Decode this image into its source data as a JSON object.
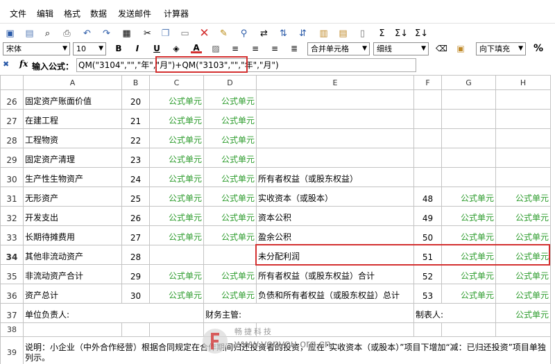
{
  "menu": [
    "文件",
    "编辑",
    "格式",
    "数据",
    "发送邮件",
    "计算器"
  ],
  "toolbar": {
    "font_name": "宋体",
    "font_size": "10",
    "bold": "B",
    "italic": "I",
    "underline": "U",
    "font_color": "A",
    "merge_label": "合并单元格",
    "border_label": "细线",
    "fill_label": "向下填充",
    "percent": "%",
    "sum": "Σ",
    "sum2": "Σ↓",
    "sum3": "Σ↓"
  },
  "formula": {
    "label": "输入公式：",
    "value": "QM(\"3104\",\"\",\"年\",\"月\")+QM(\"3103\",\"\",\"年\",\"月\")"
  },
  "columns": [
    "A",
    "B",
    "C",
    "D",
    "E",
    "F",
    "G",
    "H"
  ],
  "rows": [
    {
      "n": "26",
      "a": "固定资产账面价值",
      "b": "20",
      "c": "公式单元",
      "d": "公式单元",
      "e": "",
      "f": "",
      "g": "",
      "h": ""
    },
    {
      "n": "27",
      "a": "在建工程",
      "b": "21",
      "c": "公式单元",
      "d": "公式单元",
      "e": "",
      "f": "",
      "g": "",
      "h": ""
    },
    {
      "n": "28",
      "a": "工程物资",
      "b": "22",
      "c": "公式单元",
      "d": "公式单元",
      "e": "",
      "f": "",
      "g": "",
      "h": ""
    },
    {
      "n": "29",
      "a": "固定资产清理",
      "b": "23",
      "c": "公式单元",
      "d": "公式单元",
      "e": "",
      "f": "",
      "g": "",
      "h": ""
    },
    {
      "n": "30",
      "a": "生产性生物资产",
      "b": "24",
      "c": "公式单元",
      "d": "公式单元",
      "e": "所有者权益（或股东权益）",
      "f": "",
      "g": "",
      "h": ""
    },
    {
      "n": "31",
      "a": "无形资产",
      "b": "25",
      "c": "公式单元",
      "d": "公式单元",
      "e": "实收资本（或股本）",
      "f": "48",
      "g": "公式单元",
      "h": "公式单元"
    },
    {
      "n": "32",
      "a": "开发支出",
      "b": "26",
      "c": "公式单元",
      "d": "公式单元",
      "e": "资本公积",
      "f": "49",
      "g": "公式单元",
      "h": "公式单元"
    },
    {
      "n": "33",
      "a": "长期待摊费用",
      "b": "27",
      "c": "公式单元",
      "d": "公式单元",
      "e": "盈余公积",
      "f": "50",
      "g": "公式单元",
      "h": "公式单元"
    },
    {
      "n": "34",
      "a": "其他非流动资产",
      "b": "28",
      "c": "",
      "d": "",
      "e": "未分配利润",
      "f": "51",
      "g": "公式单元",
      "h": "公式单元"
    },
    {
      "n": "35",
      "a": "非流动资产合计",
      "b": "29",
      "c": "公式单元",
      "d": "公式单元",
      "e": "所有者权益（或股东权益）合计",
      "f": "52",
      "g": "公式单元",
      "h": "公式单元"
    },
    {
      "n": "36",
      "a": "资产总计",
      "b": "30",
      "c": "公式单元",
      "d": "公式单元",
      "e": "负债和所有者权益（或股东权益）总计",
      "f": "53",
      "g": "公式单元",
      "h": "公式单元"
    }
  ],
  "row37": {
    "n": "37",
    "a": "单位负责人:",
    "d": "财务主管:",
    "f": "制表人:",
    "h": "公式单元"
  },
  "row38": {
    "n": "38"
  },
  "row39": {
    "n": "39",
    "a": "说明：小企业（中外合作经营）根据合同规定在合作期间归还投资者的投资，应在“实收资本（或股本）”项目下增加“减：已归还投资”项目单独列示。"
  },
  "watermark": {
    "brand": "畅捷科技",
    "url": "www.yonyou.org.cn"
  }
}
